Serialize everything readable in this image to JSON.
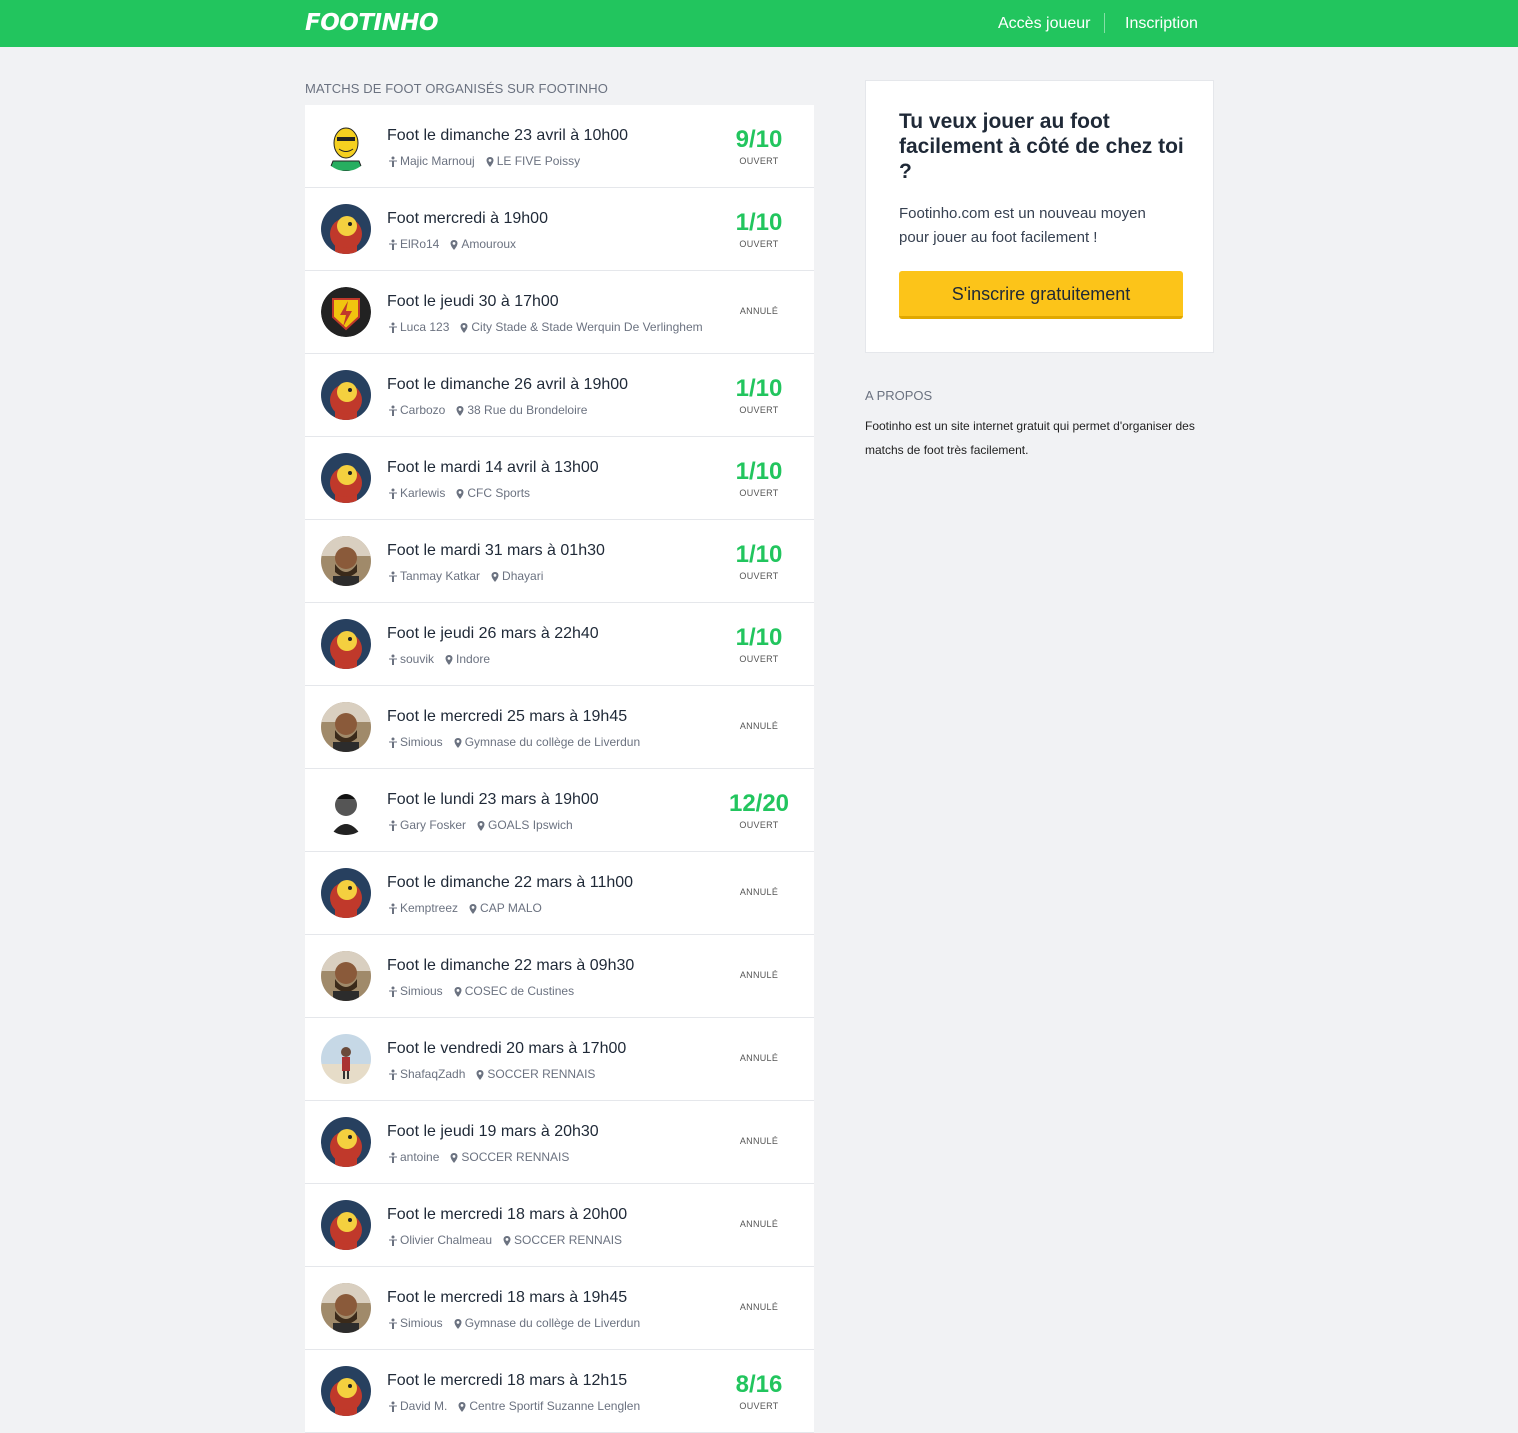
{
  "header": {
    "logo": "FOOTINHO",
    "nav": {
      "login": "Accès joueur",
      "register": "Inscription"
    },
    "colors": {
      "bar": "#22c55e"
    }
  },
  "matches": {
    "section_title": "MATCHS DE FOOT ORGANISÉS SUR FOOTINHO",
    "items": [
      {
        "title": "Foot le dimanche 23 avril à 10h00",
        "player": "Majic Marnouj",
        "place": "LE FIVE Poissy",
        "count": "9/10",
        "status": "OUVERT",
        "avatar": "cartoon-avatar"
      },
      {
        "title": "Foot mercredi à 19h00",
        "player": "ElRo14",
        "place": "Amouroux",
        "count": "1/10",
        "status": "OUVERT",
        "avatar": "default-avatar"
      },
      {
        "title": "Foot le jeudi 30 à 17h00",
        "player": "Luca 123",
        "place": "City Stade & Stade Werquin De Verlinghem",
        "count": "",
        "status": "ANNULÉ",
        "avatar": "badge-avatar"
      },
      {
        "title": "Foot le dimanche 26 avril à 19h00",
        "player": "Carbozo",
        "place": "38 Rue du Brondeloire",
        "count": "1/10",
        "status": "OUVERT",
        "avatar": "default-avatar"
      },
      {
        "title": "Foot le mardi 14 avril à 13h00",
        "player": "Karlewis",
        "place": "CFC Sports",
        "count": "1/10",
        "status": "OUVERT",
        "avatar": "default-avatar"
      },
      {
        "title": "Foot le mardi 31 mars à 01h30",
        "player": "Tanmay Katkar",
        "place": "Dhayari",
        "count": "1/10",
        "status": "OUVERT",
        "avatar": "photo-avatar"
      },
      {
        "title": "Foot le jeudi 26 mars à 22h40",
        "player": "souvik",
        "place": "Indore",
        "count": "1/10",
        "status": "OUVERT",
        "avatar": "default-avatar"
      },
      {
        "title": "Foot le mercredi 25 mars à 19h45",
        "player": "Simious",
        "place": "Gymnase du collège de Liverdun",
        "count": "",
        "status": "ANNULÉ",
        "avatar": "photo-avatar"
      },
      {
        "title": "Foot le lundi 23 mars à 19h00",
        "player": "Gary Fosker",
        "place": "GOALS Ipswich",
        "count": "12/20",
        "status": "OUVERT",
        "avatar": "bw-avatar"
      },
      {
        "title": "Foot le dimanche 22 mars à 11h00",
        "player": "Kemptreez",
        "place": "CAP MALO",
        "count": "",
        "status": "ANNULÉ",
        "avatar": "default-avatar"
      },
      {
        "title": "Foot le dimanche 22 mars à 09h30",
        "player": "Simious",
        "place": "COSEC de Custines",
        "count": "",
        "status": "ANNULÉ",
        "avatar": "photo-avatar"
      },
      {
        "title": "Foot le vendredi 20 mars à 17h00",
        "player": "ShafaqZadh",
        "place": "SOCCER RENNAIS",
        "count": "",
        "status": "ANNULÉ",
        "avatar": "beach-avatar"
      },
      {
        "title": "Foot le jeudi 19 mars à 20h30",
        "player": "antoine",
        "place": "SOCCER RENNAIS",
        "count": "",
        "status": "ANNULÉ",
        "avatar": "default-avatar"
      },
      {
        "title": "Foot le mercredi 18 mars à 20h00",
        "player": "Olivier Chalmeau",
        "place": "SOCCER RENNAIS",
        "count": "",
        "status": "ANNULÉ",
        "avatar": "default-avatar"
      },
      {
        "title": "Foot le mercredi 18 mars à 19h45",
        "player": "Simious",
        "place": "Gymnase du collège de Liverdun",
        "count": "",
        "status": "ANNULÉ",
        "avatar": "photo-avatar"
      },
      {
        "title": "Foot le mercredi 18 mars à 12h15",
        "player": "David M.",
        "place": "Centre Sportif Suzanne Lenglen",
        "count": "8/16",
        "status": "OUVERT",
        "avatar": "default-avatar"
      }
    ]
  },
  "promo": {
    "title": "Tu veux jouer au foot facilement à côté de chez toi ?",
    "text": "Footinho.com est un nouveau moyen pour jouer au foot facilement !",
    "cta": "S'inscrire gratuitement",
    "colors": {
      "cta": "#fcc419"
    }
  },
  "about": {
    "title": "A PROPOS",
    "text": "Footinho est un site internet gratuit qui permet d'organiser des matchs de foot très facilement."
  }
}
